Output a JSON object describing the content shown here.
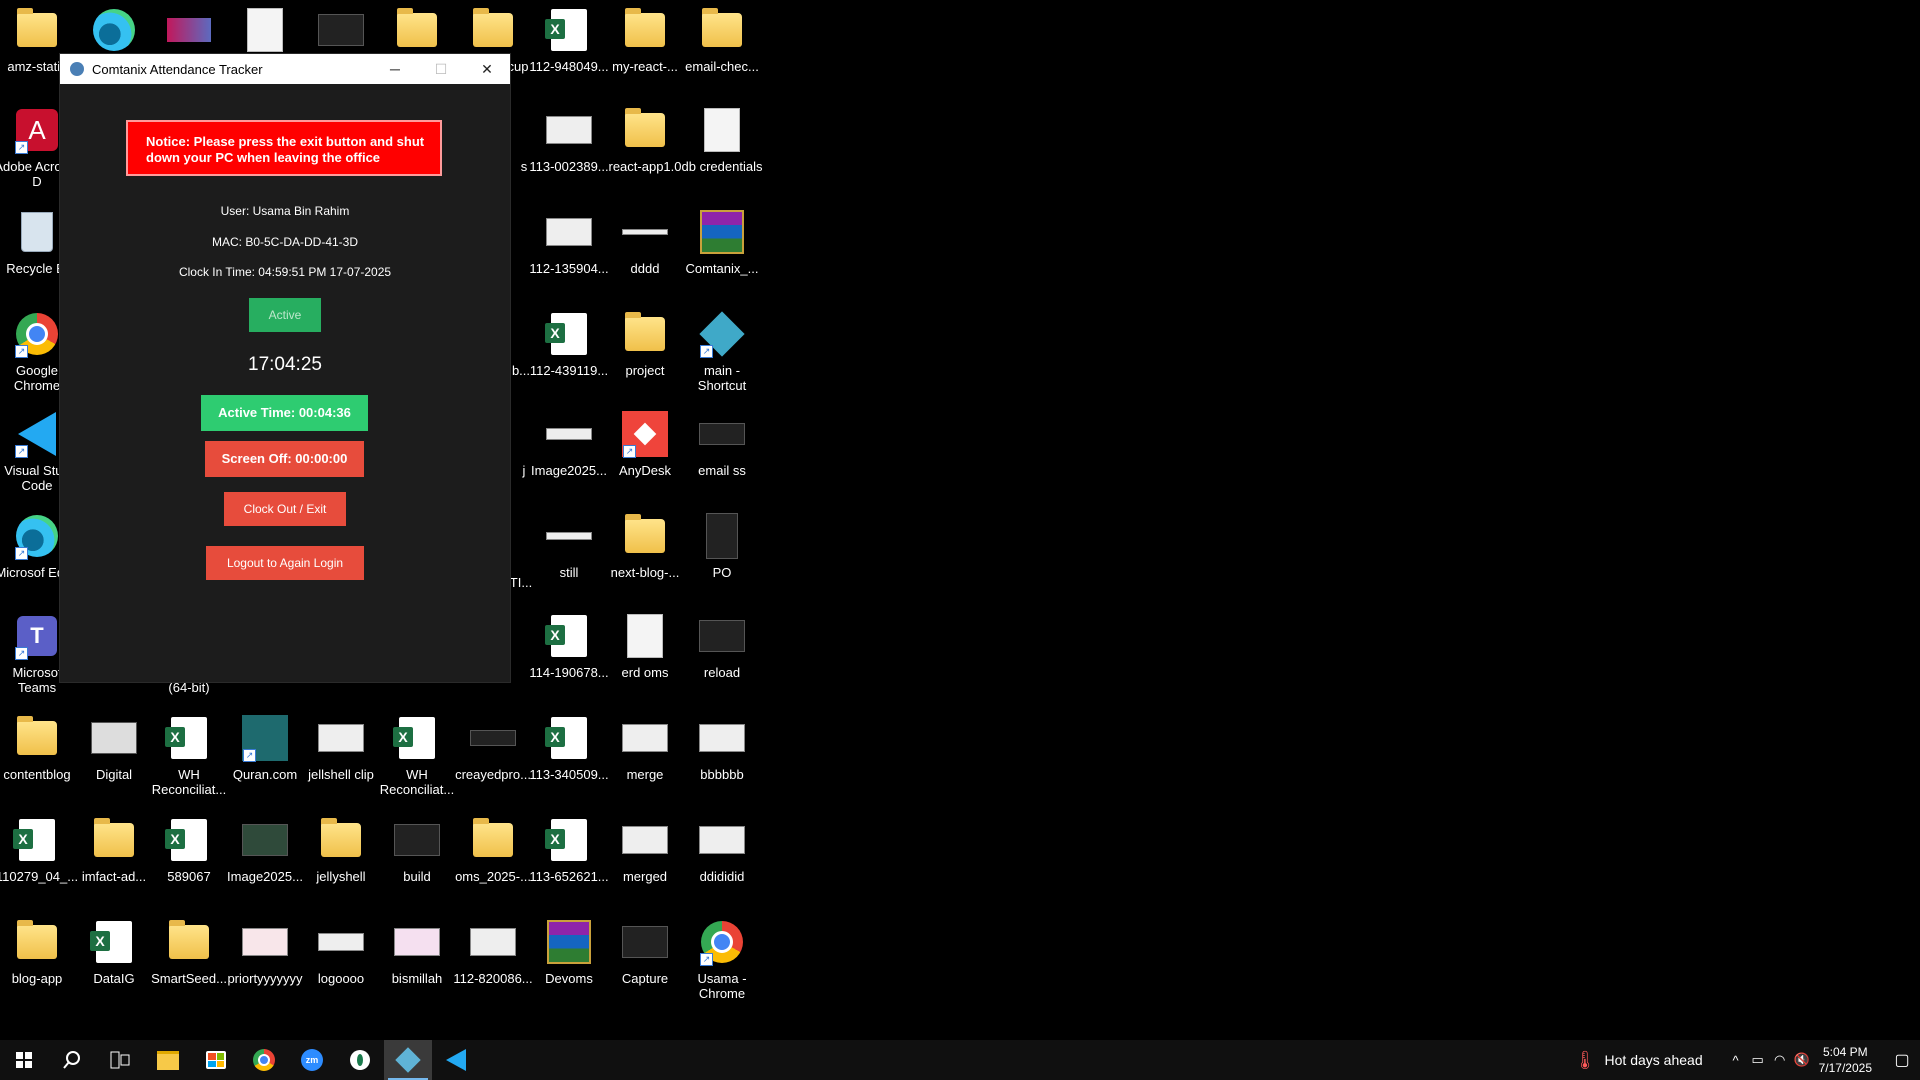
{
  "desktop": {
    "icons": [
      {
        "label": "amz-static",
        "type": "folder"
      },
      {
        "label": "Adobe Acrobat D",
        "type": "acrobat"
      },
      {
        "label": "Recycle Bi",
        "type": "recycle"
      },
      {
        "label": "Google Chrome",
        "type": "chrome"
      },
      {
        "label": "Visual Stud Code",
        "type": "vscode"
      },
      {
        "label": "Microsof Edge",
        "type": "edge"
      },
      {
        "label": "Microsof Teams",
        "type": "teams"
      },
      {
        "label": "contentblog",
        "type": "folder"
      },
      {
        "label": "110279_04_...",
        "type": "excel"
      },
      {
        "label": "blog-app",
        "type": "folder"
      },
      {
        "label": "Digital",
        "type": "dark-thumb"
      },
      {
        "label": "imfact-ad...",
        "type": "folder"
      },
      {
        "label": "DataIG",
        "type": "excel"
      },
      {
        "label": "WH Reconciliat...",
        "type": "excel"
      },
      {
        "label": "589067",
        "type": "excel"
      },
      {
        "label": "SmartSeed...",
        "type": "folder"
      },
      {
        "label": "Quran.com",
        "type": "quran"
      },
      {
        "label": "Image2025...",
        "type": "dark-thumb"
      },
      {
        "label": "priortyyyyyyy",
        "type": "thumb"
      },
      {
        "label": "jellshell clip",
        "type": "thumb"
      },
      {
        "label": "jellyshell",
        "type": "folder"
      },
      {
        "label": "logoooo",
        "type": "thumb"
      },
      {
        "label": "WH Reconciliat...",
        "type": "excel"
      },
      {
        "label": "build",
        "type": "dark-thumb"
      },
      {
        "label": "bismillah",
        "type": "thumb"
      },
      {
        "label": "creayedpro...",
        "type": "dark-thumb"
      },
      {
        "label": "oms_2025-...",
        "type": "folder"
      },
      {
        "label": "112-820086...",
        "type": "thumb"
      },
      {
        "label": "cup",
        "type": "folder"
      },
      {
        "label": "112-948049...",
        "type": "excel"
      },
      {
        "label": "113-002389...",
        "type": "thumb"
      },
      {
        "label": "112-135904...",
        "type": "thumb"
      },
      {
        "label": "112-439119...",
        "type": "excel"
      },
      {
        "label": "Image2025...",
        "type": "thumb"
      },
      {
        "label": "still",
        "type": "thumb"
      },
      {
        "label": "114-190678...",
        "type": "excel"
      },
      {
        "label": "113-340509...",
        "type": "excel"
      },
      {
        "label": "113-652621...",
        "type": "excel"
      },
      {
        "label": "Devoms",
        "type": "winrar"
      },
      {
        "label": "my-react-...",
        "type": "folder"
      },
      {
        "label": "react-app1.0",
        "type": "folder"
      },
      {
        "label": "dddd",
        "type": "thumb"
      },
      {
        "label": "project",
        "type": "folder"
      },
      {
        "label": "AnyDesk",
        "type": "anydesk"
      },
      {
        "label": "next-blog-...",
        "type": "folder"
      },
      {
        "label": "erd oms",
        "type": "doc"
      },
      {
        "label": "merge",
        "type": "thumb"
      },
      {
        "label": "merged",
        "type": "thumb"
      },
      {
        "label": "Capture",
        "type": "dark-thumb"
      },
      {
        "label": "email-chec...",
        "type": "folder"
      },
      {
        "label": "db credentials",
        "type": "doc"
      },
      {
        "label": "Comtanix_...",
        "type": "winrar"
      },
      {
        "label": "main - Shortcut",
        "type": "diamond"
      },
      {
        "label": "email ss",
        "type": "dark-thumb"
      },
      {
        "label": "PO",
        "type": "dark-thumb"
      },
      {
        "label": "reload",
        "type": "dark-thumb"
      },
      {
        "label": "bbbbbb",
        "type": "thumb"
      },
      {
        "label": "ddididid",
        "type": "thumb"
      },
      {
        "label": "Usama - Chrome",
        "type": "chrome"
      },
      {
        "label": "(64-bit)",
        "type": "none"
      },
      {
        "label": "s",
        "type": "none"
      },
      {
        "label": "b...",
        "type": "none"
      },
      {
        "label": "j",
        "type": "none"
      },
      {
        "label": "TI...",
        "type": "none"
      }
    ]
  },
  "window": {
    "title": "Comtanix Attendance Tracker",
    "minimize": "─",
    "maximize": "☐",
    "close": "✕",
    "notice": "Notice: Please press the exit button and shut down your PC when leaving the office",
    "user": "User: Usama Bin Rahim",
    "mac": "MAC: B0-5C-DA-DD-41-3D",
    "clock_in": "Clock In Time: 04:59:51 PM 17-07-2025",
    "status": "Active",
    "clock": "17:04:25",
    "active_time": "Active Time: 00:04:36",
    "screen_off": "Screen Off: 00:00:00",
    "clock_out": "Clock Out / Exit",
    "logout": "Logout to Again Login"
  },
  "taskbar": {
    "weather": "Hot days ahead",
    "time": "5:04 PM",
    "date": "7/17/2025"
  }
}
